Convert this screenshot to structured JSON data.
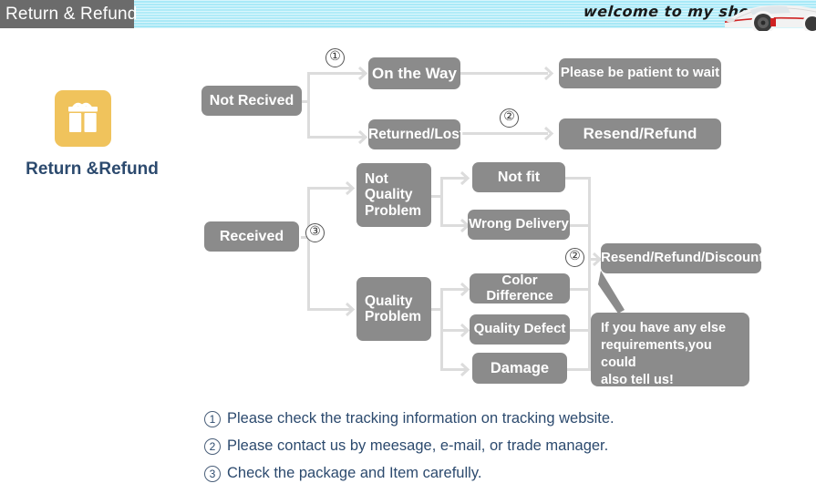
{
  "header": {
    "title": "Return & Refund",
    "welcome": "welcome to my shop",
    "banner_color": "#a6e9f8",
    "tab_color": "#6b6b6b",
    "car_icon": "sports-car-image"
  },
  "brand": {
    "icon": "gift-box-icon",
    "icon_color": "#f0c35c",
    "label": "Return &Refund",
    "label_color": "#2c4a6e"
  },
  "flow": {
    "node_color": "#8b8b8b",
    "connector_color": "#dcdcdc",
    "nodes": [
      {
        "id": "not-received",
        "label": "Not Recived"
      },
      {
        "id": "on-the-way",
        "label": "On the Way"
      },
      {
        "id": "returned-lost",
        "label": "Returned/Lost"
      },
      {
        "id": "please-be-patient",
        "label": "Please be patient to wait"
      },
      {
        "id": "resend-refund",
        "label": "Resend/Refund"
      },
      {
        "id": "received",
        "label": "Received"
      },
      {
        "id": "not-quality-problem",
        "label": "Not Quality Problem"
      },
      {
        "id": "not-fit",
        "label": "Not fit"
      },
      {
        "id": "wrong-delivery",
        "label": "Wrong Delivery"
      },
      {
        "id": "quality-problem",
        "label": "Quality Problem"
      },
      {
        "id": "color-difference",
        "label": "Color Difference"
      },
      {
        "id": "quality-defect",
        "label": "Quality Defect"
      },
      {
        "id": "damage",
        "label": "Damage"
      },
      {
        "id": "resend-refund-discount",
        "label": "Resend/Refund/Discount"
      }
    ],
    "multiline": {
      "not_quality_problem": [
        "Not",
        "Quality",
        "Problem"
      ],
      "quality_problem": [
        "Quality",
        "Problem"
      ]
    },
    "markers": [
      {
        "id": "marker-1-tracking",
        "label": "①"
      },
      {
        "id": "marker-2-contact-top",
        "label": "②"
      },
      {
        "id": "marker-3-check-package",
        "label": "③"
      },
      {
        "id": "marker-2-contact-bottom",
        "label": "②"
      }
    ],
    "callout": {
      "id": "extra-requirements-callout",
      "lines": [
        "If you have any else",
        "requirements,you could",
        "also tell us!"
      ]
    }
  },
  "notes": [
    {
      "num": "1",
      "text": "Please check the tracking information on tracking website."
    },
    {
      "num": "2",
      "text": "Please contact us by meesage, e-mail, or trade manager."
    },
    {
      "num": "3",
      "text": "Check the package and Item carefully."
    }
  ]
}
